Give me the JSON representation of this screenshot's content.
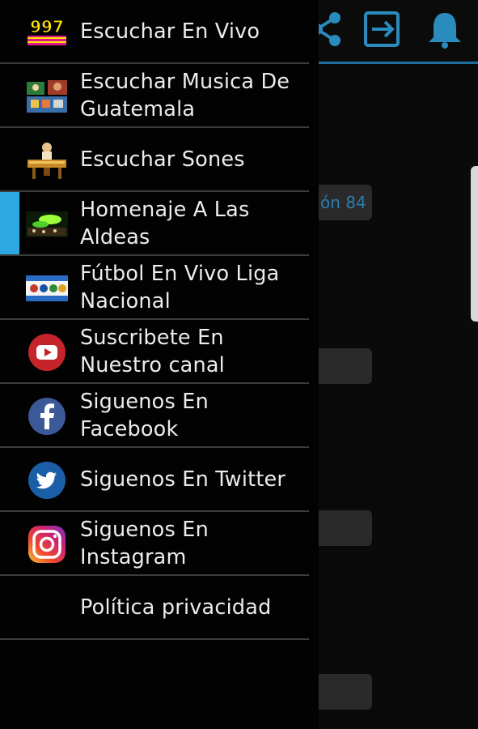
{
  "background": {
    "header_icons": [
      "share-icon",
      "exit-icon",
      "bell-icon"
    ],
    "partial_text": "ón 84",
    "accent": "#1a6f9a"
  },
  "drawer": {
    "active_color": "#2ea8e0",
    "items": [
      {
        "label": "Escuchar En Vivo",
        "icon": "radio-997-logo-icon",
        "logo_text": "997"
      },
      {
        "label": "Escuchar Musica De Guatemala",
        "icon": "guatemala-music-icon"
      },
      {
        "label": "Escuchar Sones",
        "icon": "marimba-player-icon"
      },
      {
        "label": "Homenaje A Las Aldeas",
        "icon": "village-tribute-icon",
        "active": true
      },
      {
        "label": "Fútbol En Vivo Liga Nacional",
        "icon": "football-league-icon"
      },
      {
        "label": "Suscribete En Nuestro canal",
        "icon": "youtube-icon"
      },
      {
        "label": "Siguenos En Facebook",
        "icon": "facebook-icon"
      },
      {
        "label": "Siguenos En Twitter",
        "icon": "twitter-icon"
      },
      {
        "label": "Siguenos En Instagram",
        "icon": "instagram-icon"
      },
      {
        "label": "Política privacidad",
        "icon": ""
      }
    ]
  }
}
